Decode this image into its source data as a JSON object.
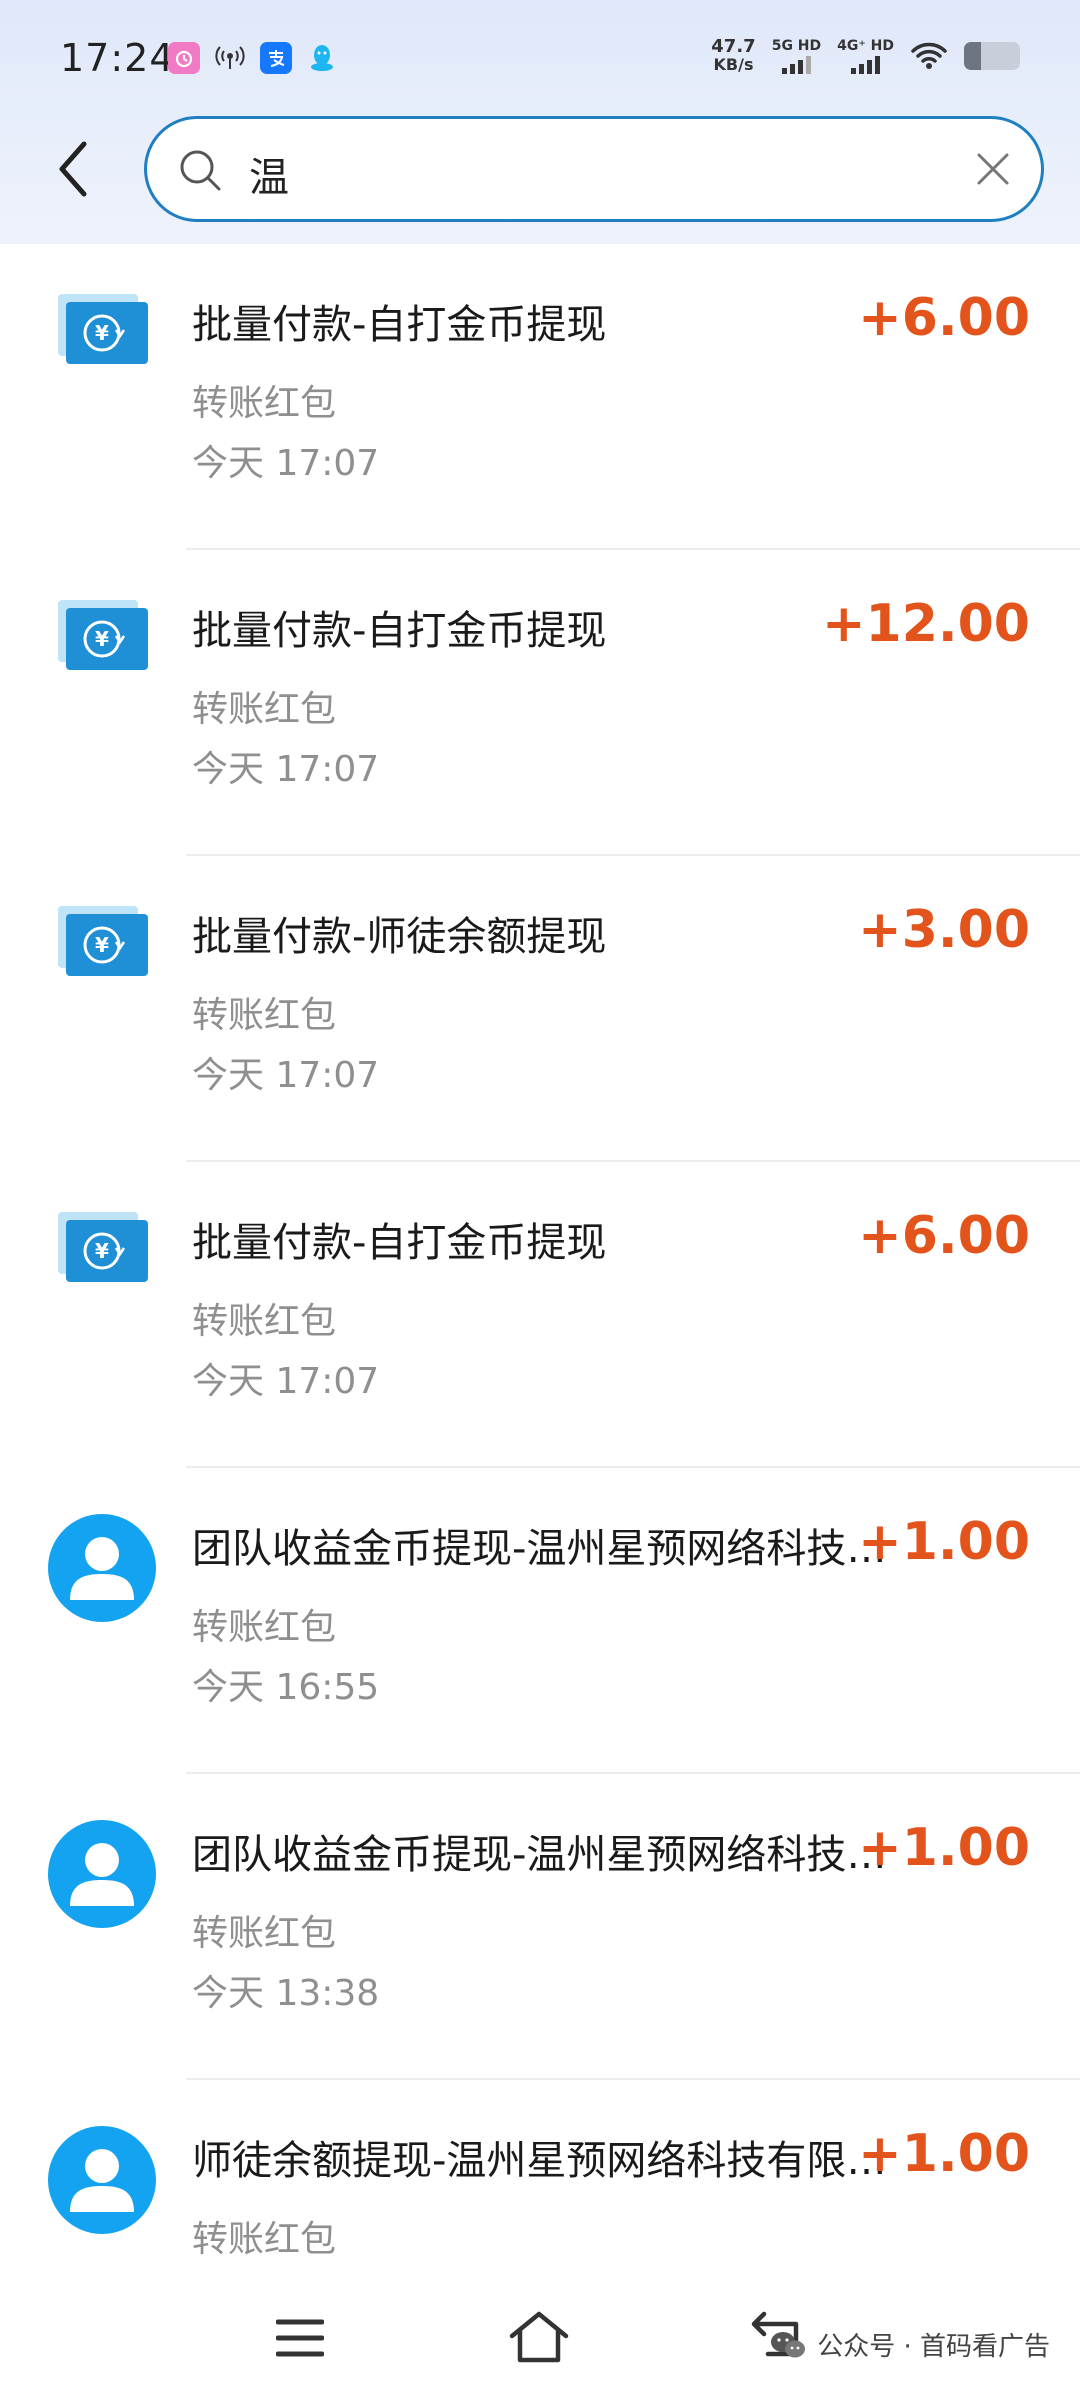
{
  "status_bar": {
    "time": "17:24",
    "net_speed_value": "47.7",
    "net_speed_unit": "KB/s",
    "sim1_label": "5G HD",
    "sim2_label": "4G⁺ HD",
    "battery_level": 0.3,
    "icons": [
      "alarm-icon",
      "hotspot-icon",
      "alipay-icon",
      "qq-icon",
      "wifi-icon"
    ]
  },
  "search": {
    "query": "温"
  },
  "transactions": [
    {
      "title": "批量付款-自打金币提现",
      "amount": "+6.00",
      "type": "转账红包",
      "time": "今天 17:07",
      "icon": "red-packet-icon"
    },
    {
      "title": "批量付款-自打金币提现",
      "amount": "+12.00",
      "type": "转账红包",
      "time": "今天 17:07",
      "icon": "red-packet-icon"
    },
    {
      "title": "批量付款-师徒余额提现",
      "amount": "+3.00",
      "type": "转账红包",
      "time": "今天 17:07",
      "icon": "red-packet-icon"
    },
    {
      "title": "批量付款-自打金币提现",
      "amount": "+6.00",
      "type": "转账红包",
      "time": "今天 17:07",
      "icon": "red-packet-icon"
    },
    {
      "title": "团队收益金币提现-温州星预网络科技有限公司",
      "amount": "+1.00",
      "type": "转账红包",
      "time": "今天 16:55",
      "icon": "user-avatar-icon"
    },
    {
      "title": "团队收益金币提现-温州星预网络科技有限公司",
      "amount": "+1.00",
      "type": "转账红包",
      "time": "今天 13:38",
      "icon": "user-avatar-icon"
    },
    {
      "title": "师徒余额提现-温州星预网络科技有限公司",
      "amount": "+1.00",
      "type": "转账红包",
      "time": "",
      "icon": "user-avatar-icon"
    }
  ],
  "watermark": {
    "text": "公众号 · 首码看广告"
  },
  "colors": {
    "amount": "#e2541b",
    "search_border": "#1f7fc0",
    "avatar_blue": "#14a3f0"
  }
}
